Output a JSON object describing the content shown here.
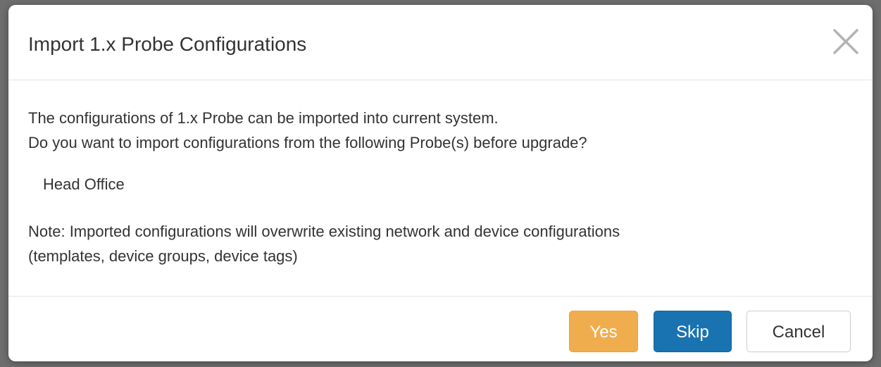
{
  "dialog": {
    "title": "Import 1.x Probe Configurations",
    "close_icon": "close-icon"
  },
  "body": {
    "line1": "The configurations of 1.x Probe can be imported into current system.",
    "line2": "Do you want to import configurations from the following Probe(s) before upgrade?",
    "probes": [
      "Head Office"
    ],
    "note_line1": "Note: Imported configurations will overwrite existing network and device configurations",
    "note_line2": "(templates, device groups, device tags)"
  },
  "footer": {
    "yes_label": "Yes",
    "skip_label": "Skip",
    "cancel_label": "Cancel"
  },
  "colors": {
    "yes": "#f0ad4e",
    "skip": "#1a73b1",
    "cancel": "#ffffff"
  }
}
